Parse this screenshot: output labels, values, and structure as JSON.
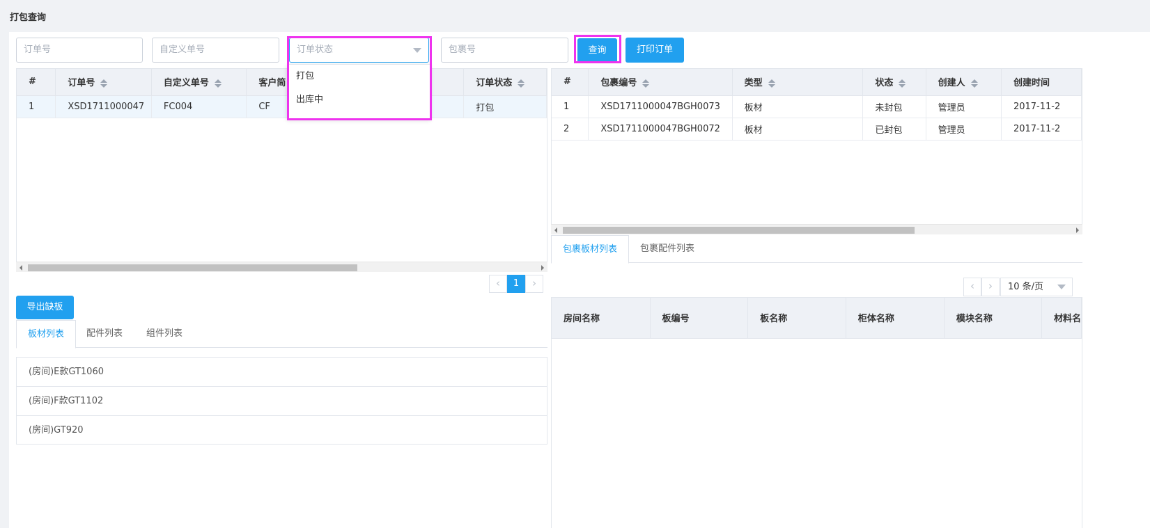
{
  "page": {
    "title": "打包查询"
  },
  "search": {
    "order_no_placeholder": "订单号",
    "custom_no_placeholder": "自定义单号",
    "status_placeholder": "订单状态",
    "package_no_placeholder": "包裹号",
    "query_label": "查询",
    "print_label": "打印订单"
  },
  "status_dropdown": {
    "options": [
      "打包",
      "出库中"
    ]
  },
  "orders_table": {
    "headers": [
      "#",
      "订单号",
      "自定义单号",
      "客户简",
      "订单状态"
    ],
    "rows": [
      [
        "1",
        "XSD1711000047",
        "FC004",
        "CF",
        "打包"
      ]
    ]
  },
  "orders_pager": {
    "current": "1",
    "prev": "‹",
    "next": "›"
  },
  "export_button": {
    "label": "导出缺板"
  },
  "left_tabs": [
    "板材列表",
    "配件列表",
    "组件列表"
  ],
  "board_list": [
    "(房间)E款GT1060",
    "(房间)F款GT1102",
    "(房间)GT920"
  ],
  "packages_table": {
    "headers": [
      "#",
      "包裹编号",
      "类型",
      "状态",
      "创建人",
      "创建时间"
    ],
    "rows": [
      [
        "1",
        "XSD1711000047BGH0073",
        "板材",
        "未封包",
        "管理员",
        "2017-11-2"
      ],
      [
        "2",
        "XSD1711000047BGH0072",
        "板材",
        "已封包",
        "管理员",
        "2017-11-2"
      ]
    ]
  },
  "right_tabs": [
    "包裹板材列表",
    "包裹配件列表"
  ],
  "right_pager": {
    "prev": "‹",
    "next": "›",
    "page_size": "10 条/页"
  },
  "boards_table": {
    "headers": [
      "房间名称",
      "板编号",
      "板名称",
      "柜体名称",
      "模块名称",
      "材料名"
    ]
  },
  "colors": {
    "accent": "#21a0ef",
    "highlight": "#ee33ee",
    "header_bg": "#eef1f6"
  }
}
